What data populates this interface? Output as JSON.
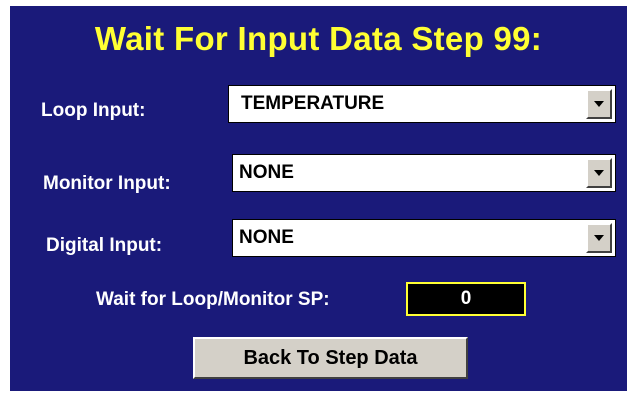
{
  "title": "Wait For Input Data Step 99:",
  "loop_input": {
    "label": "Loop Input:",
    "value": "TEMPERATURE"
  },
  "monitor_input": {
    "label": "Monitor Input:",
    "value": "NONE"
  },
  "digital_input": {
    "label": "Digital Input:",
    "value": "NONE"
  },
  "wait_sp": {
    "label": "Wait for Loop/Monitor SP:",
    "value": "0"
  },
  "back_button": {
    "label": "Back To Step Data"
  },
  "colors": {
    "panel_background": "#1a1a7a",
    "title": "#ffff33",
    "label": "#ffffff",
    "sp_border": "#ffff33",
    "button_face": "#d4d0c8"
  },
  "icons": {
    "dropdown": "chevron-down-icon"
  }
}
